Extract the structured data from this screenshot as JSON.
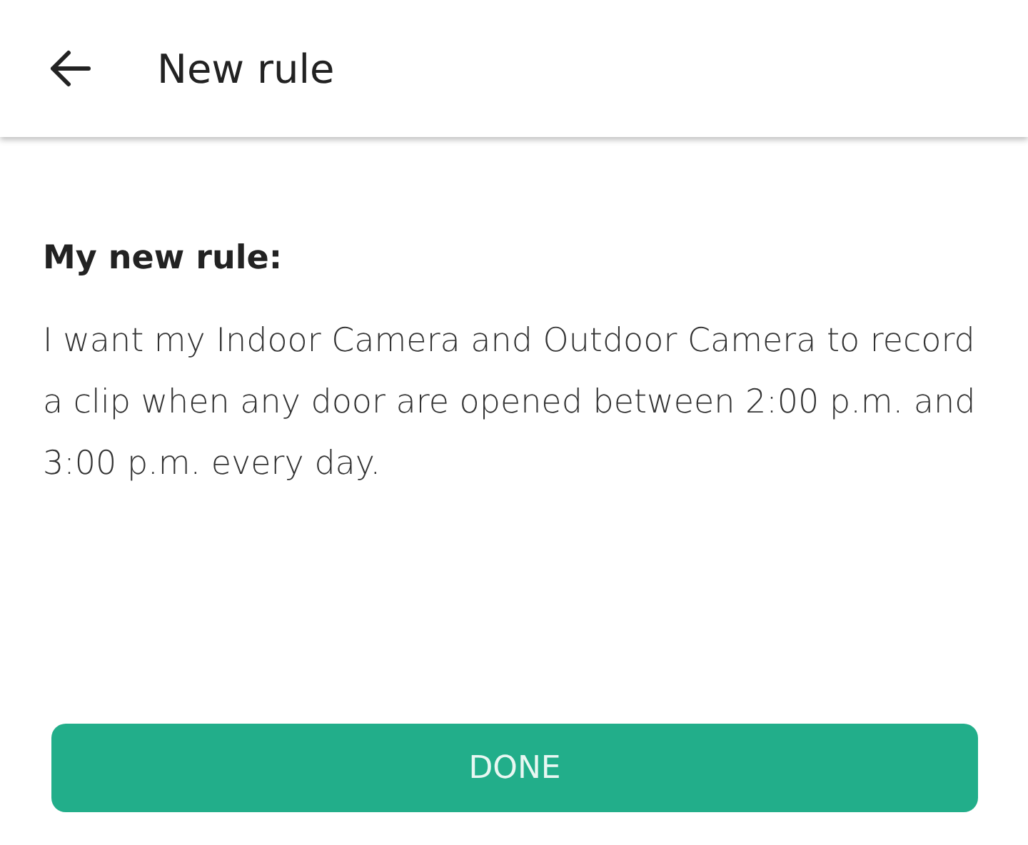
{
  "header": {
    "title": "New rule"
  },
  "rule": {
    "heading": "My new rule:",
    "text": "I want my Indoor Camera and Outdoor Camera to record a clip when any door are opened between 2:00 p.m. and 3:00 p.m. every day."
  },
  "buttons": [
    "DONE"
  ]
}
